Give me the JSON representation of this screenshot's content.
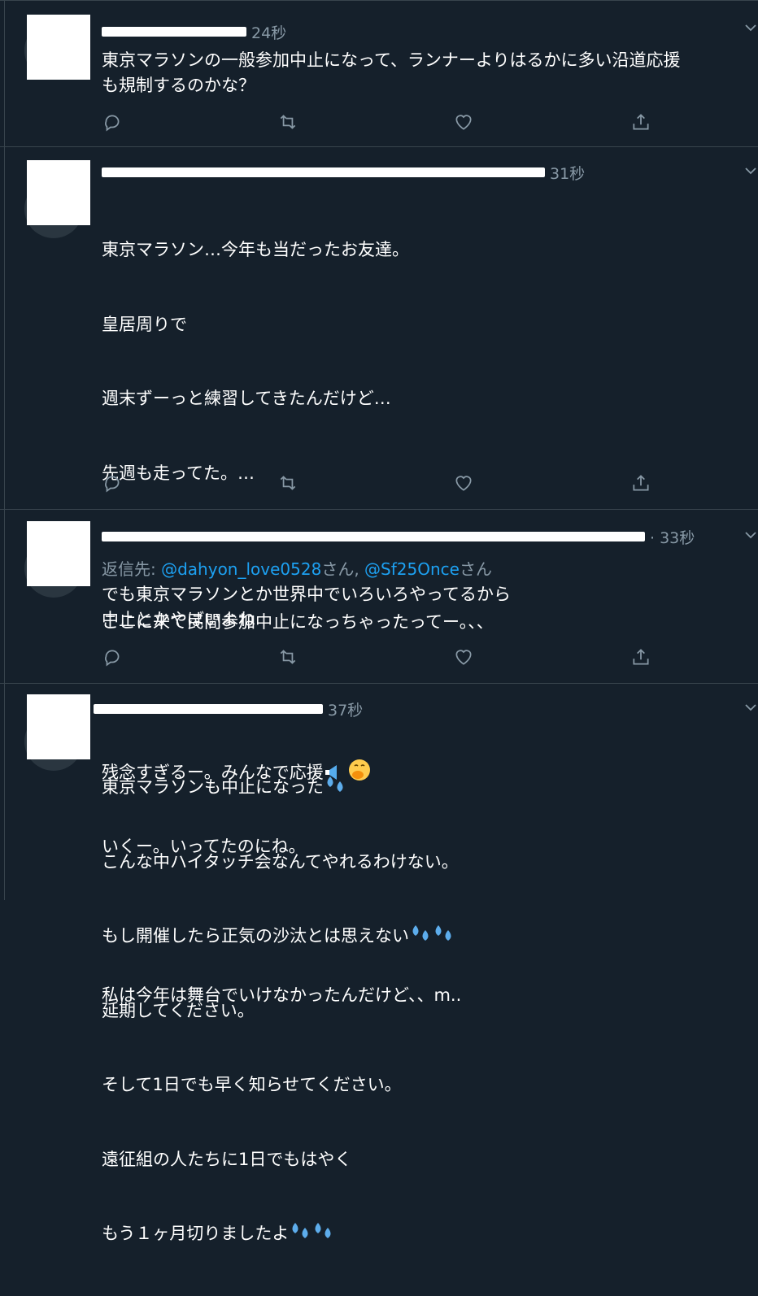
{
  "colors": {
    "background": "#15202b",
    "text": "#ffffff",
    "muted": "#8899a6",
    "link": "#1da1f2",
    "divider": "#38444d"
  },
  "tweets": [
    {
      "time": "24秒",
      "lines": [
        "東京マラソンの一般参加中止になって、ランナーよりはるかに多い沿道応援",
        "も規制するのかな？"
      ]
    },
    {
      "time": "31秒",
      "lines": [
        "東京マラソン…今年も当だったお友達。",
        "皇居周りで",
        "週末ずーっと練習してきたんだけど…",
        "先週も走ってた。…",
        "",
        "ここに来て民間参加中止になっちゃったってー。、、",
        "",
        "残念すぎるー。みんなで応援",
        "いくー。いってたのにね。",
        "",
        "私は今年は舞台でいけなかったんだけど、、m.."
      ]
    },
    {
      "time": "· 33秒",
      "reply_prefix": "返信先: ",
      "mention1": "@dahyon_love0528",
      "san1": "さん, ",
      "mention2": "@Sf25Once",
      "san2": "さん",
      "lines": [
        "でも東京マラソンとか世界中でいろいろやってるから",
        "中止とかやばいよね"
      ]
    },
    {
      "time": "37秒",
      "lines": [
        "東京マラソンも中止になった",
        "こんな中ハイタッチ会なんてやれるわけない。",
        "もし開催したら正気の沙汰とは思えない",
        "延期してください。",
        "そして1日でも早く知らせてください。",
        "遠征組の人たちに1日でもはやく",
        "もう１ヶ月切りましたよ"
      ]
    }
  ],
  "icons": {
    "reply": "reply-icon",
    "retweet": "retweet-icon",
    "like": "heart-icon",
    "share": "share-icon",
    "more": "chevron-down-icon"
  }
}
